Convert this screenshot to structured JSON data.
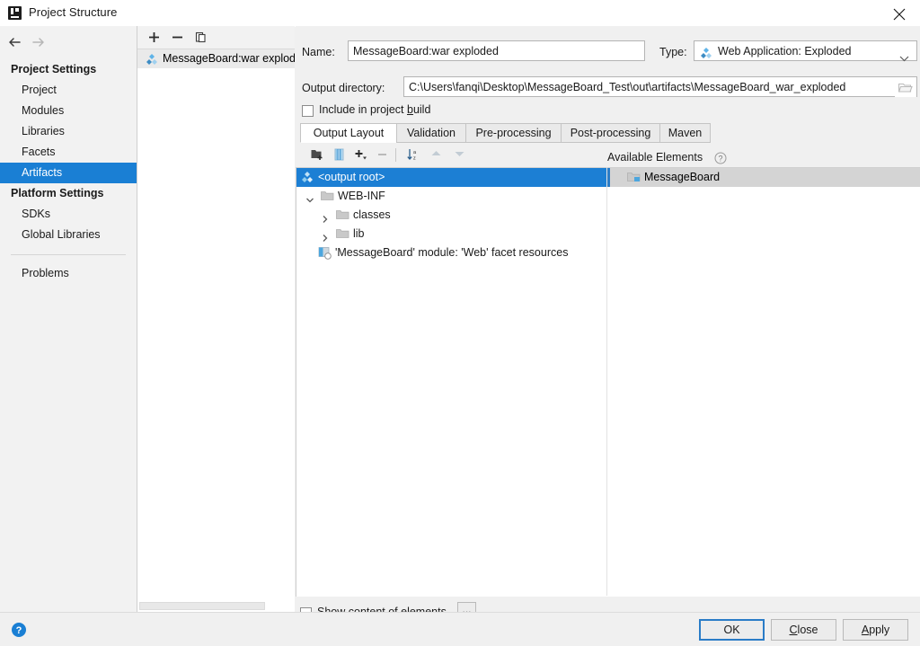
{
  "window": {
    "title": "Project Structure",
    "app_icon": "intellij-idea-icon",
    "close_label": "✕"
  },
  "sidebar": {
    "nav": {
      "back": "back-arrow",
      "forward": "forward-arrow"
    },
    "groups": [
      {
        "label": "Project Settings",
        "items": [
          {
            "label": "Project",
            "selected": false
          },
          {
            "label": "Modules",
            "selected": false
          },
          {
            "label": "Libraries",
            "selected": false
          },
          {
            "label": "Facets",
            "selected": false
          },
          {
            "label": "Artifacts",
            "selected": true
          }
        ]
      },
      {
        "label": "Platform Settings",
        "items": [
          {
            "label": "SDKs",
            "selected": false
          },
          {
            "label": "Global Libraries",
            "selected": false
          }
        ]
      }
    ],
    "problems": {
      "label": "Problems"
    }
  },
  "artifact_list": {
    "toolbar": [
      {
        "name": "add-artifact-button",
        "glyph": "plus"
      },
      {
        "name": "remove-artifact-button",
        "glyph": "minus"
      },
      {
        "name": "copy-artifact-button",
        "glyph": "copy"
      }
    ],
    "items": [
      {
        "label": "MessageBoard:war exploded",
        "icon": "artifact-icon",
        "selected": true
      }
    ]
  },
  "form": {
    "name_label": "Name:",
    "name_value": "MessageBoard:war exploded",
    "type_label": "Type:",
    "type_value": "Web Application: Exploded",
    "type_icon": "artifact-icon",
    "output_dir_label": "Output directory:",
    "output_dir_value": "C:\\Users\\fanqi\\Desktop\\MessageBoard_Test\\out\\artifacts\\MessageBoard_war_exploded",
    "browse_icon": "folder-browse-icon",
    "include_in_build": {
      "label_before": "Include in project ",
      "label_mnemonic": "b",
      "label_after": "uild",
      "checked": false
    }
  },
  "tabs": [
    {
      "label": "Output Layout",
      "active": true
    },
    {
      "label": "Validation",
      "active": false
    },
    {
      "label": "Pre-processing",
      "active": false
    },
    {
      "label": "Post-processing",
      "active": false
    },
    {
      "label": "Maven",
      "active": false
    }
  ],
  "layout_toolbar": [
    {
      "name": "create-directory-button",
      "glyph": "folder-add-icon",
      "enabled": true
    },
    {
      "name": "create-archive-button",
      "glyph": "archive-icon",
      "enabled": true
    },
    {
      "name": "add-copy-of-button",
      "glyph": "plus-dropdown-icon",
      "enabled": true
    },
    {
      "name": "remove-element-button",
      "glyph": "minus-icon",
      "enabled": false
    },
    {
      "name": "sort-button",
      "glyph": "sort-az-icon",
      "enabled": true
    },
    {
      "name": "move-up-button",
      "glyph": "arrow-up-icon",
      "enabled": false
    },
    {
      "name": "move-down-button",
      "glyph": "arrow-down-icon",
      "enabled": false
    }
  ],
  "output_tree": [
    {
      "label": "<output root>",
      "icon": "artifact-icon",
      "indent": 0,
      "twisty": "none",
      "selected": true
    },
    {
      "label": "WEB-INF",
      "icon": "folder-icon",
      "indent": 1,
      "twisty": "expanded",
      "selected": false
    },
    {
      "label": "classes",
      "icon": "folder-icon",
      "indent": 2,
      "twisty": "collapsed",
      "selected": false
    },
    {
      "label": "lib",
      "icon": "folder-icon",
      "indent": 2,
      "twisty": "collapsed",
      "selected": false
    },
    {
      "label": "'MessageBoard' module: 'Web' facet resources",
      "icon": "facet-resources-icon",
      "indent": 2,
      "twisty": "none",
      "selected": false
    }
  ],
  "available_elements": {
    "header": "Available Elements",
    "help_icon": "help-circle-icon",
    "items": [
      {
        "label": "MessageBoard",
        "icon": "module-icon",
        "selected": true
      }
    ]
  },
  "footer": {
    "show_content": {
      "label": "Show content of elements",
      "checked": false
    },
    "ellipsis_button": "..."
  },
  "bottom_bar": {
    "help_icon": "help-circle-icon",
    "buttons": [
      {
        "label": "OK",
        "mnemonic": "",
        "default": true
      },
      {
        "label_before": "",
        "mnemonic": "C",
        "label_after": "lose",
        "label": "Close",
        "default": false
      },
      {
        "label_before": "",
        "mnemonic": "A",
        "label_after": "pply",
        "label": "Apply",
        "default": false
      }
    ]
  },
  "colors": {
    "selection_blue": "#1a7fd4",
    "tree_selection_blue": "#1c7fd4",
    "inactive_selection_gray": "#d4d4d4",
    "accent_blue": "#2a7cc7",
    "dialog_bg": "#f0f0f0"
  }
}
